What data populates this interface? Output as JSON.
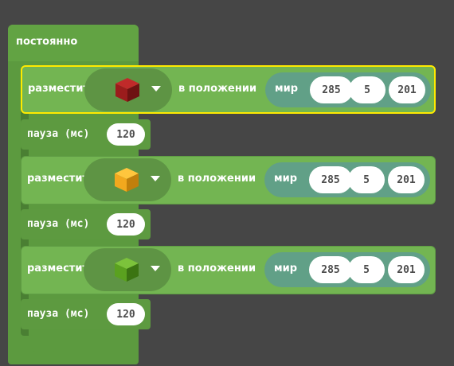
{
  "forever": {
    "label": "постоянно"
  },
  "place_blocks": [
    {
      "label": "разместить",
      "cube_color": "#9b1c1c",
      "cube_color_top": "#c02a2a",
      "cube_color_side": "#6e1212",
      "position_label": "в положении",
      "coord_label": "мир",
      "x": "285",
      "y": "5",
      "z": "201",
      "selected": true
    },
    {
      "label": "разместить",
      "cube_color": "#f2a81e",
      "cube_color_top": "#ffc63d",
      "cube_color_side": "#c07f0c",
      "position_label": "в положении",
      "coord_label": "мир",
      "x": "285",
      "y": "5",
      "z": "201",
      "selected": false
    },
    {
      "label": "разместить",
      "cube_color": "#5aa11f",
      "cube_color_top": "#7cc33b",
      "cube_color_side": "#3b7412",
      "position_label": "в положении",
      "coord_label": "мир",
      "x": "285",
      "y": "5",
      "z": "201",
      "selected": false
    }
  ],
  "pause_blocks": [
    {
      "label": "пауза (мс)",
      "value": "120"
    },
    {
      "label": "пауза (мс)",
      "value": "120"
    },
    {
      "label": "пауза (мс)",
      "value": "120"
    }
  ],
  "colors": {
    "workspace_bg": "#464646",
    "loop_green": "#5c9a3f",
    "block_green": "#73b552",
    "world_teal": "#61a087",
    "selection_outline": "#ffea00"
  },
  "icons": {
    "dropdown": "caret-down-icon",
    "block_picker": "cube-icon"
  }
}
